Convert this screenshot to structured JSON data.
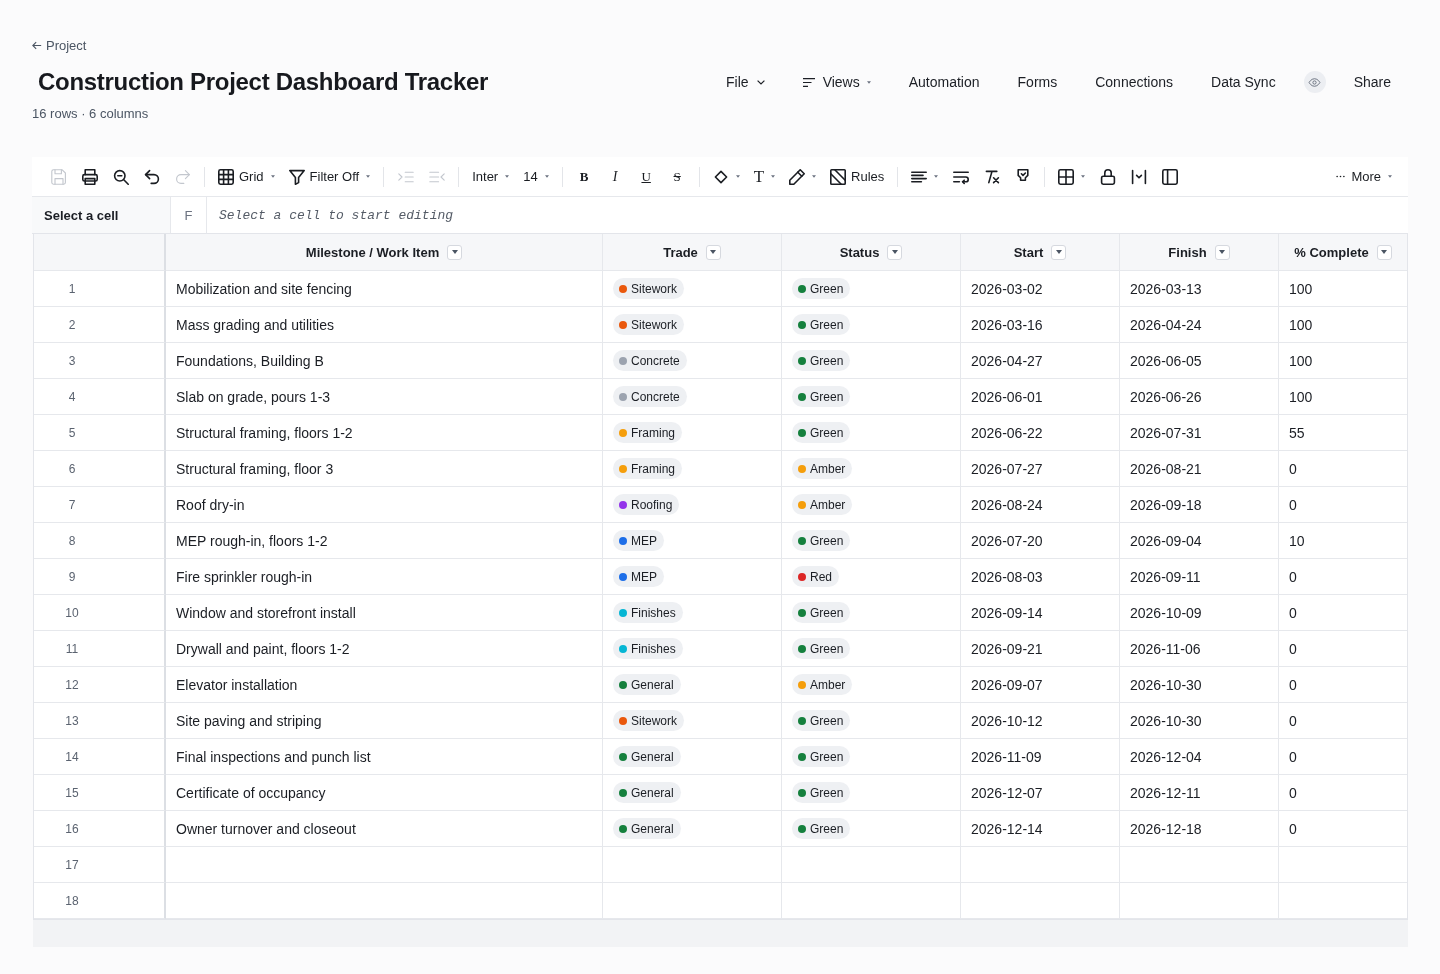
{
  "back_link": {
    "label": "Project"
  },
  "title": "Construction Project Dashboard Tracker",
  "subtitle": "16 rows · 6 columns",
  "nav": [
    {
      "label": "File",
      "kind": "menu"
    },
    {
      "label": "Views",
      "kind": "views"
    },
    {
      "label": "Automation",
      "kind": "link"
    },
    {
      "label": "Forms",
      "kind": "link"
    },
    {
      "label": "Connections",
      "kind": "link"
    },
    {
      "label": "Data Sync",
      "kind": "link"
    }
  ],
  "share": {
    "label": "Share"
  },
  "toolbar": {
    "groups": [
      [
        {
          "kind": "save",
          "disabled": true,
          "menu": false
        },
        {
          "kind": "print",
          "disabled": false,
          "menu": false
        },
        {
          "kind": "zoom",
          "disabled": false,
          "menu": false
        },
        {
          "kind": "undo",
          "disabled": false,
          "menu": false
        },
        {
          "kind": "redo",
          "disabled": true,
          "menu": false
        }
      ],
      [
        {
          "kind": "grid",
          "label": "Grid",
          "disabled": false,
          "menu": true
        },
        {
          "kind": "filter",
          "label": "Filter Off",
          "disabled": false,
          "menu": true
        }
      ],
      [
        {
          "kind": "indent",
          "disabled": true,
          "menu": false
        },
        {
          "kind": "outdent",
          "disabled": true,
          "menu": false
        }
      ],
      [
        {
          "kind": "font",
          "label": "Inter",
          "disabled": false,
          "menu": true
        },
        {
          "kind": "size",
          "label": "14",
          "disabled": false,
          "menu": true
        }
      ],
      [
        {
          "kind": "bold",
          "label": "B",
          "disabled": false,
          "menu": false
        },
        {
          "kind": "italic",
          "label": "I",
          "disabled": false,
          "menu": false
        },
        {
          "kind": "underline",
          "label": "U",
          "disabled": false,
          "menu": false
        },
        {
          "kind": "strike",
          "label": "S",
          "disabled": false,
          "menu": false
        }
      ],
      [
        {
          "kind": "fill",
          "disabled": false,
          "menu": true
        },
        {
          "kind": "color",
          "label": "T",
          "disabled": false,
          "menu": true
        },
        {
          "kind": "pen",
          "disabled": false,
          "menu": true
        },
        {
          "kind": "rules",
          "label": "Rules",
          "disabled": false,
          "menu": false
        }
      ],
      [
        {
          "kind": "align",
          "disabled": false,
          "menu": true
        },
        {
          "kind": "wrap",
          "disabled": false,
          "menu": false
        },
        {
          "kind": "clearformat",
          "disabled": false,
          "menu": false
        },
        {
          "kind": "paintformat",
          "disabled": false,
          "menu": false
        }
      ],
      [
        {
          "kind": "borders",
          "disabled": false,
          "menu": true
        },
        {
          "kind": "lock",
          "disabled": false,
          "menu": false
        },
        {
          "kind": "colwidth",
          "disabled": false,
          "menu": false
        },
        {
          "kind": "panel",
          "disabled": false,
          "menu": false
        }
      ]
    ],
    "overflow": {
      "label": "More",
      "menu": true
    }
  },
  "formula_bar": {
    "cell_reference": "Select a cell",
    "function_label": "F",
    "placeholder": "Select a cell to start editing"
  },
  "table": {
    "columns": [
      {
        "label": "Milestone / Work Item"
      },
      {
        "label": "Trade"
      },
      {
        "label": "Status"
      },
      {
        "label": "Start"
      },
      {
        "label": "Finish"
      },
      {
        "label": "% Complete"
      }
    ],
    "rows": [
      {
        "number": "1",
        "cells": [
          "Mobilization and site fencing",
          {
            "label": "Sitework",
            "color": "#ea580c"
          },
          {
            "label": "Green",
            "color": "#15803d"
          },
          "2026-03-02",
          "2026-03-13",
          "100"
        ]
      },
      {
        "number": "2",
        "cells": [
          "Mass grading and utilities",
          {
            "label": "Sitework",
            "color": "#ea580c"
          },
          {
            "label": "Green",
            "color": "#15803d"
          },
          "2026-03-16",
          "2026-04-24",
          "100"
        ]
      },
      {
        "number": "3",
        "cells": [
          "Foundations, Building B",
          {
            "label": "Concrete",
            "color": "#9ca3af"
          },
          {
            "label": "Green",
            "color": "#15803d"
          },
          "2026-04-27",
          "2026-06-05",
          "100"
        ]
      },
      {
        "number": "4",
        "cells": [
          "Slab on grade, pours 1-3",
          {
            "label": "Concrete",
            "color": "#9ca3af"
          },
          {
            "label": "Green",
            "color": "#15803d"
          },
          "2026-06-01",
          "2026-06-26",
          "100"
        ]
      },
      {
        "number": "5",
        "cells": [
          "Structural framing, floors 1-2",
          {
            "label": "Framing",
            "color": "#f59e0b"
          },
          {
            "label": "Green",
            "color": "#15803d"
          },
          "2026-06-22",
          "2026-07-31",
          "55"
        ]
      },
      {
        "number": "6",
        "cells": [
          "Structural framing, floor 3",
          {
            "label": "Framing",
            "color": "#f59e0b"
          },
          {
            "label": "Amber",
            "color": "#f59e0b"
          },
          "2026-07-27",
          "2026-08-21",
          "0"
        ]
      },
      {
        "number": "7",
        "cells": [
          "Roof dry-in",
          {
            "label": "Roofing",
            "color": "#9333ea"
          },
          {
            "label": "Amber",
            "color": "#f59e0b"
          },
          "2026-08-24",
          "2026-09-18",
          "0"
        ]
      },
      {
        "number": "8",
        "cells": [
          "MEP rough-in, floors 1-2",
          {
            "label": "MEP",
            "color": "#1d6ee8"
          },
          {
            "label": "Green",
            "color": "#15803d"
          },
          "2026-07-20",
          "2026-09-04",
          "10"
        ]
      },
      {
        "number": "9",
        "cells": [
          "Fire sprinkler rough-in",
          {
            "label": "MEP",
            "color": "#1d6ee8"
          },
          {
            "label": "Red",
            "color": "#dc2626"
          },
          "2026-08-03",
          "2026-09-11",
          "0"
        ]
      },
      {
        "number": "10",
        "cells": [
          "Window and storefront install",
          {
            "label": "Finishes",
            "color": "#06b6d4"
          },
          {
            "label": "Green",
            "color": "#15803d"
          },
          "2026-09-14",
          "2026-10-09",
          "0"
        ]
      },
      {
        "number": "11",
        "cells": [
          "Drywall and paint, floors 1-2",
          {
            "label": "Finishes",
            "color": "#06b6d4"
          },
          {
            "label": "Green",
            "color": "#15803d"
          },
          "2026-09-21",
          "2026-11-06",
          "0"
        ]
      },
      {
        "number": "12",
        "cells": [
          "Elevator installation",
          {
            "label": "General",
            "color": "#15803d"
          },
          {
            "label": "Amber",
            "color": "#f59e0b"
          },
          "2026-09-07",
          "2026-10-30",
          "0"
        ]
      },
      {
        "number": "13",
        "cells": [
          "Site paving and striping",
          {
            "label": "Sitework",
            "color": "#ea580c"
          },
          {
            "label": "Green",
            "color": "#15803d"
          },
          "2026-10-12",
          "2026-10-30",
          "0"
        ]
      },
      {
        "number": "14",
        "cells": [
          "Final inspections and punch list",
          {
            "label": "General",
            "color": "#15803d"
          },
          {
            "label": "Green",
            "color": "#15803d"
          },
          "2026-11-09",
          "2026-12-04",
          "0"
        ]
      },
      {
        "number": "15",
        "cells": [
          "Certificate of occupancy",
          {
            "label": "General",
            "color": "#15803d"
          },
          {
            "label": "Green",
            "color": "#15803d"
          },
          "2026-12-07",
          "2026-12-11",
          "0"
        ]
      },
      {
        "number": "16",
        "cells": [
          "Owner turnover and closeout",
          {
            "label": "General",
            "color": "#15803d"
          },
          {
            "label": "Green",
            "color": "#15803d"
          },
          "2026-12-14",
          "2026-12-18",
          "0"
        ]
      },
      {
        "number": "17"
      },
      {
        "number": "18"
      }
    ]
  }
}
